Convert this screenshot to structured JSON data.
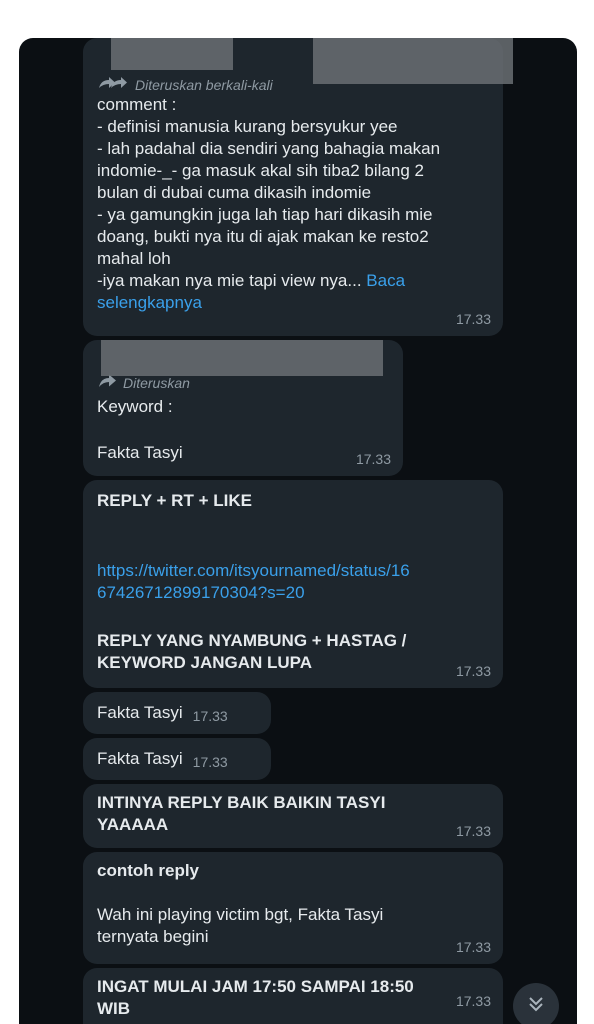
{
  "messages": {
    "m1": {
      "forwarded_label": "Diteruskan berkali-kali",
      "lines": [
        "comment :",
        "- definisi manusia kurang bersyukur yee",
        "- lah padahal dia sendiri yang bahagia makan",
        "indomie-_- ga masuk akal sih tiba2 bilang 2",
        "bulan di dubai cuma dikasih indomie",
        "- ya gamungkin juga lah tiap hari dikasih mie",
        "doang, bukti nya itu di ajak makan ke resto2",
        "mahal loh",
        "-iya makan nya mie tapi view nya..."
      ],
      "read_more": "Baca",
      "read_more_2": "selengkapnya",
      "time": "17.33"
    },
    "m2": {
      "forwarded_label": "Diteruskan",
      "line1": "Keyword :",
      "line2": "Fakta Tasyi",
      "time": "17.33"
    },
    "m3": {
      "title": "REPLY + RT + LIKE",
      "link1": "https://twitter.com/itsyournamed/status/16",
      "link2": "67426712899170304?s=20",
      "note1": "REPLY YANG NYAMBUNG + HASTAG /",
      "note2": "KEYWORD JANGAN LUPA",
      "time": "17.33"
    },
    "m4": {
      "text": "Fakta Tasyi",
      "time": "17.33"
    },
    "m5": {
      "text": "Fakta Tasyi",
      "time": "17.33"
    },
    "m6": {
      "line1": "INTINYA REPLY BAIK BAIKIN TASYI",
      "line2": "YAAAAA",
      "time": "17.33"
    },
    "m7": {
      "title": "contoh reply",
      "line1": "Wah ini playing victim bgt, Fakta Tasyi",
      "line2": "ternyata begini",
      "time": "17.33"
    },
    "m8": {
      "line1": "INGAT MULAI JAM 17:50 SAMPAI 18:50",
      "line2": "WIB",
      "time": "17.33"
    }
  },
  "icons": {
    "forward": "forward-arrow-icon",
    "double_forward": "double-forward-arrow-icon",
    "scroll": "chevron-double-down-icon"
  },
  "colors": {
    "background": "#0b0f13",
    "bubble": "#1e262d",
    "link": "#3aa0ea",
    "meta": "#8f9aa3"
  }
}
